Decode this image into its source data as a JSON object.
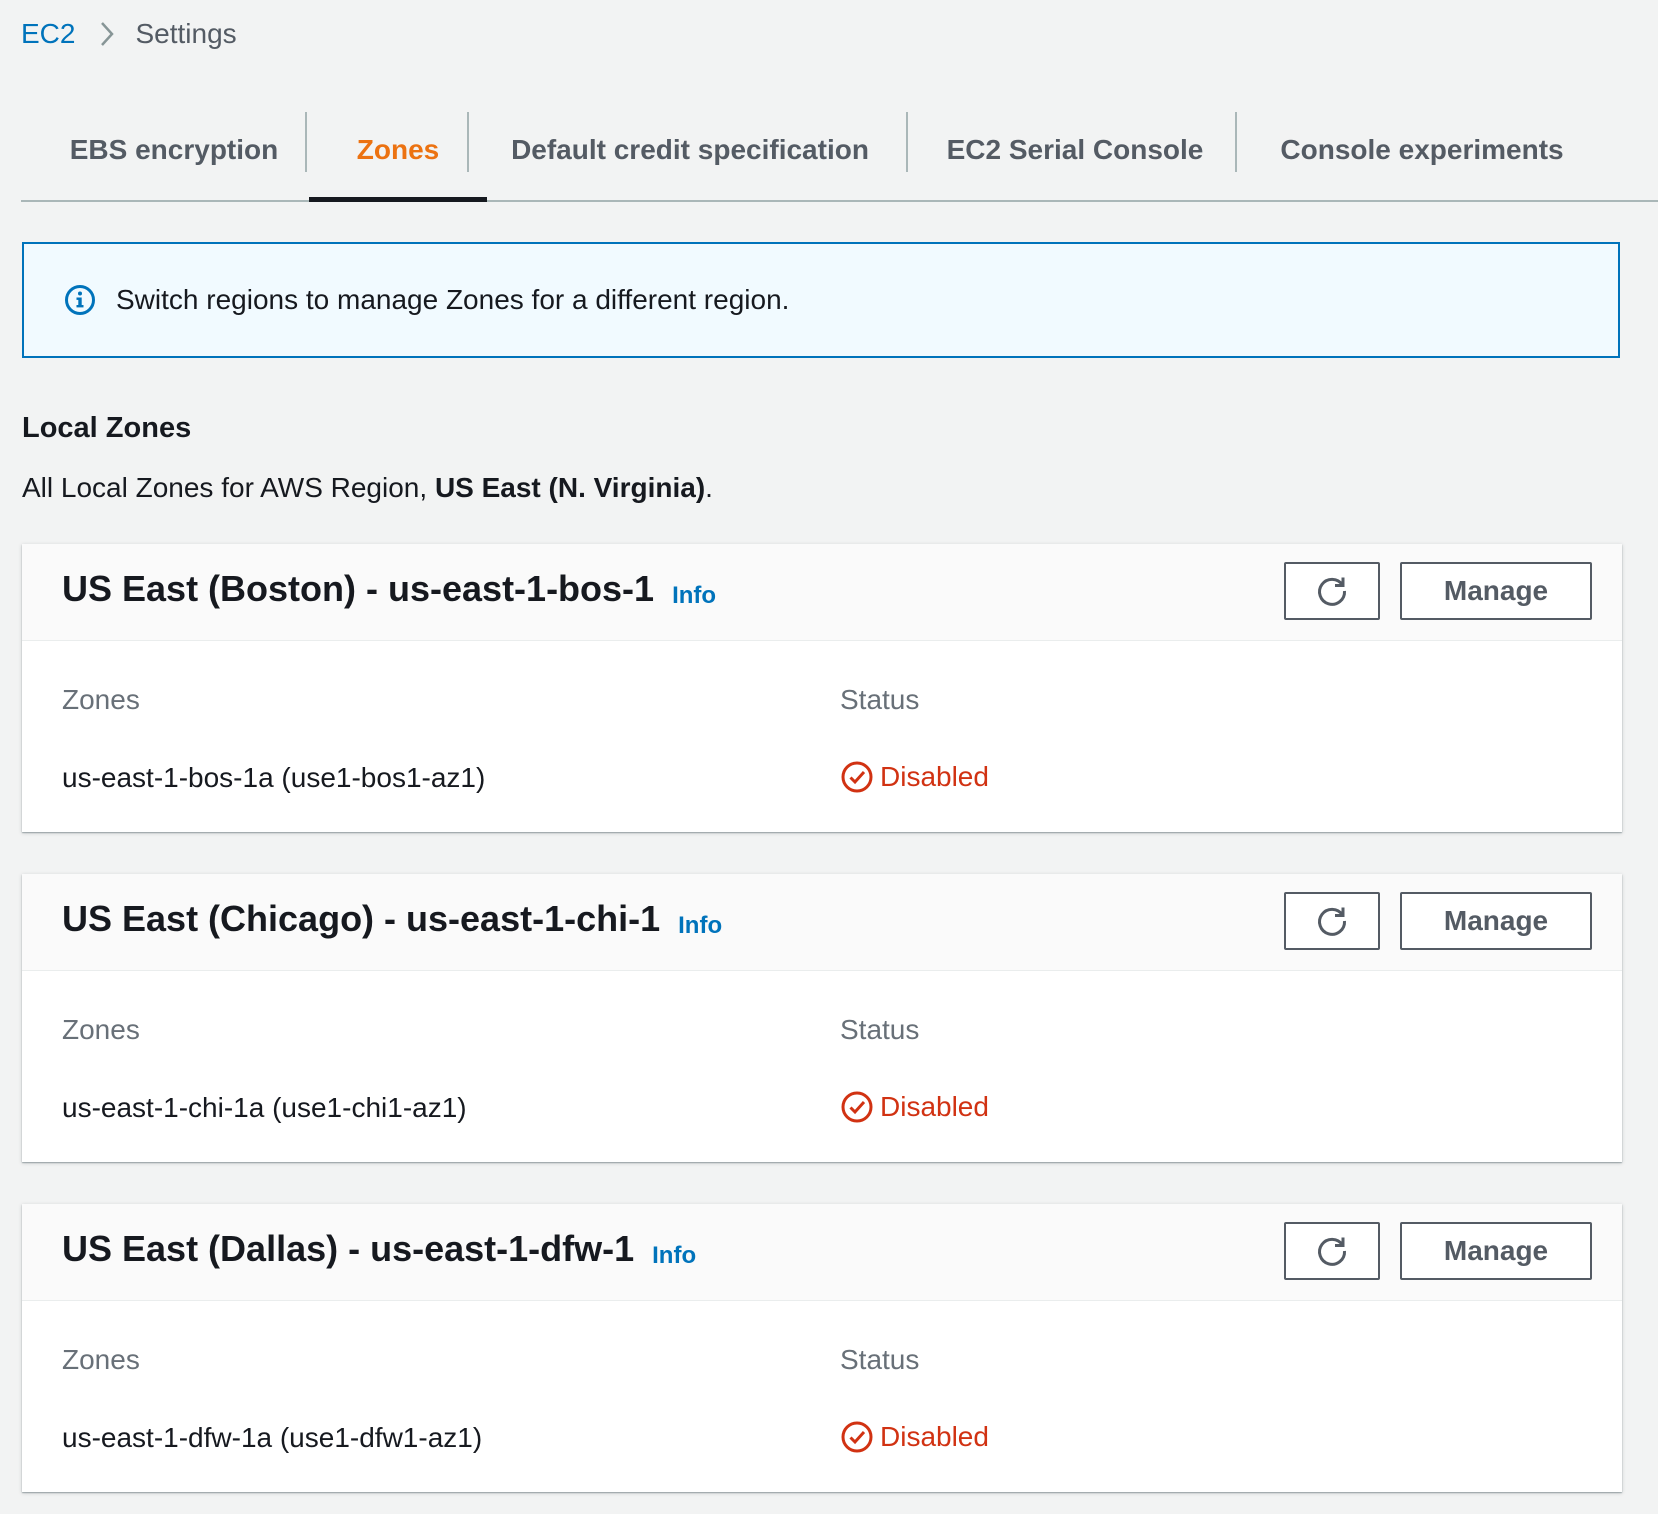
{
  "breadcrumb": {
    "root": "EC2",
    "current": "Settings"
  },
  "tabs": [
    {
      "label": "EBS encryption"
    },
    {
      "label": "Zones"
    },
    {
      "label": "Default credit specification"
    },
    {
      "label": "EC2 Serial Console"
    },
    {
      "label": "Console experiments"
    }
  ],
  "alert": {
    "text": "Switch regions to manage Zones for a different region.",
    "icon": "info-circle-icon"
  },
  "local_zones": {
    "title": "Local Zones",
    "desc_prefix": "All Local Zones for AWS Region, ",
    "desc_region": "US East (N. Virginia)",
    "desc_suffix": "."
  },
  "cards": [
    {
      "title": "US East (Boston) - us-east-1-bos-1",
      "info": "Info",
      "manage": "Manage",
      "zones_label": "Zones",
      "status_label": "Status",
      "zone": "us-east-1-bos-1a (use1-bos1-az1)",
      "status": "Disabled"
    },
    {
      "title": "US East (Chicago) - us-east-1-chi-1",
      "info": "Info",
      "manage": "Manage",
      "zones_label": "Zones",
      "status_label": "Status",
      "zone": "us-east-1-chi-1a (use1-chi1-az1)",
      "status": "Disabled"
    },
    {
      "title": "US East (Dallas) - us-east-1-dfw-1",
      "info": "Info",
      "manage": "Manage",
      "zones_label": "Zones",
      "status_label": "Status",
      "zone": "us-east-1-dfw-1a (use1-dfw1-az1)",
      "status": "Disabled"
    }
  ],
  "colors": {
    "link": "#0073bb",
    "active_tab": "#ec7211",
    "error": "#d13212",
    "alert_bg": "#f1faff"
  }
}
